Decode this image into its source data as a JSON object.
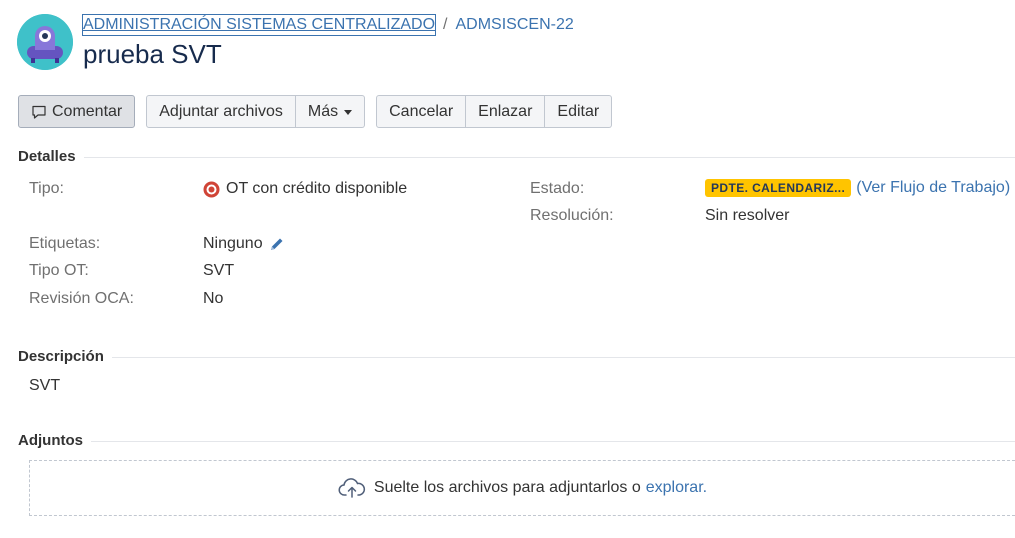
{
  "breadcrumb": {
    "project": "ADMINISTRACIÓN SISTEMAS CENTRALIZADO",
    "separator": "/",
    "issue_key": "ADMSISCEN-22"
  },
  "issue": {
    "title": "prueba SVT"
  },
  "toolbar": {
    "comment": "Comentar",
    "attach": "Adjuntar archivos",
    "more": "Más",
    "cancel": "Cancelar",
    "link": "Enlazar",
    "edit": "Editar"
  },
  "details": {
    "heading": "Detalles",
    "tipo_label": "Tipo:",
    "tipo_value": "OT con crédito disponible",
    "etiquetas_label": "Etiquetas:",
    "etiquetas_value": "Ninguno",
    "tipo_ot_label": "Tipo OT:",
    "tipo_ot_value": "SVT",
    "revision_label": "Revisión OCA:",
    "revision_value": "No",
    "estado_label": "Estado:",
    "estado_value": "PDTE. CALENDARIZ...",
    "workflow_open": "(",
    "workflow_link": "Ver Flujo de Trabajo",
    "workflow_close": ")",
    "resolucion_label": "Resolución:",
    "resolucion_value": "Sin resolver"
  },
  "description": {
    "heading": "Descripción",
    "text": "SVT"
  },
  "attachments": {
    "heading": "Adjuntos",
    "drop_text": "Suelte los archivos para adjuntarlos o",
    "browse_link": "explorar."
  },
  "colors": {
    "link": "#3b73af",
    "status_lozenge": "#ffc400",
    "avatar": "#3fc1c9"
  }
}
